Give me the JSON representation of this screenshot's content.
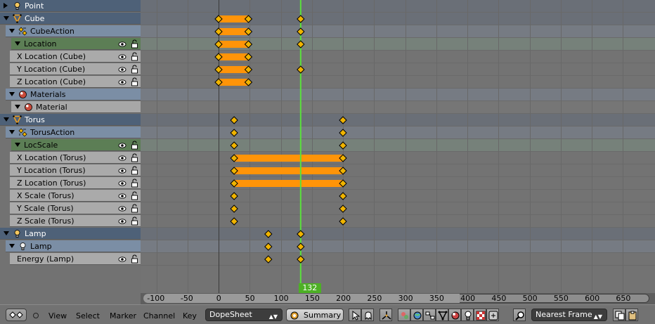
{
  "channels": [
    {
      "label": "Point",
      "level": "object",
      "indent": 0,
      "icon": "lamp-icon",
      "expanded": false
    },
    {
      "label": "Cube",
      "level": "object",
      "indent": 0,
      "icon": "mesh-icon",
      "expanded": true
    },
    {
      "label": "CubeAction",
      "level": "action",
      "indent": 1,
      "icon": "action-icon",
      "expanded": true
    },
    {
      "label": "Location",
      "level": "group",
      "indent": 2,
      "icon": "",
      "expanded": true
    },
    {
      "label": "X Location (Cube)",
      "level": "fcurve",
      "indent": 3,
      "icon": ""
    },
    {
      "label": "Y Location (Cube)",
      "level": "fcurve",
      "indent": 3,
      "icon": ""
    },
    {
      "label": "Z Location (Cube)",
      "level": "fcurve",
      "indent": 3,
      "icon": ""
    },
    {
      "label": "Materials",
      "level": "matgroup",
      "indent": 1,
      "icon": "material-icon",
      "expanded": true
    },
    {
      "label": "Material",
      "level": "material",
      "indent": 2,
      "icon": "material-icon",
      "expanded": true
    },
    {
      "label": "Torus",
      "level": "object",
      "indent": 0,
      "icon": "mesh-icon",
      "expanded": true
    },
    {
      "label": "TorusAction",
      "level": "action",
      "indent": 1,
      "icon": "action-icon",
      "expanded": true
    },
    {
      "label": "LocScale",
      "level": "group",
      "indent": 2,
      "icon": "",
      "expanded": true
    },
    {
      "label": "X Location (Torus)",
      "level": "fcurve",
      "indent": 3,
      "icon": ""
    },
    {
      "label": "Y Location (Torus)",
      "level": "fcurve",
      "indent": 3,
      "icon": ""
    },
    {
      "label": "Z Location (Torus)",
      "level": "fcurve",
      "indent": 3,
      "icon": ""
    },
    {
      "label": "X Scale (Torus)",
      "level": "fcurve",
      "indent": 3,
      "icon": ""
    },
    {
      "label": "Y Scale (Torus)",
      "level": "fcurve",
      "indent": 3,
      "icon": ""
    },
    {
      "label": "Z Scale (Torus)",
      "level": "fcurve",
      "indent": 3,
      "icon": ""
    },
    {
      "label": "Lamp",
      "level": "object",
      "indent": 0,
      "icon": "lamp-icon",
      "expanded": true
    },
    {
      "label": "Lamp",
      "level": "action",
      "indent": 1,
      "icon": "lamp-data-icon",
      "expanded": true
    },
    {
      "label": "Energy (Lamp)",
      "level": "fcurve",
      "indent": 1,
      "icon": ""
    }
  ],
  "keyframes": [
    {
      "row": 1,
      "frames": [
        0,
        48,
        132
      ],
      "holds": [
        [
          0,
          48
        ]
      ]
    },
    {
      "row": 2,
      "frames": [
        0,
        48,
        132
      ],
      "holds": [
        [
          0,
          48
        ]
      ]
    },
    {
      "row": 3,
      "frames": [
        0,
        48,
        132
      ],
      "holds": [
        [
          0,
          48
        ]
      ]
    },
    {
      "row": 4,
      "frames": [
        0,
        48
      ],
      "holds": [
        [
          0,
          48
        ]
      ]
    },
    {
      "row": 5,
      "frames": [
        0,
        48,
        132
      ],
      "holds": [
        [
          0,
          48
        ]
      ]
    },
    {
      "row": 6,
      "frames": [
        0,
        48
      ],
      "holds": [
        [
          0,
          48
        ]
      ]
    },
    {
      "row": 9,
      "frames": [
        25,
        200
      ],
      "holds": []
    },
    {
      "row": 10,
      "frames": [
        25,
        200
      ],
      "holds": []
    },
    {
      "row": 11,
      "frames": [
        25,
        200
      ],
      "holds": []
    },
    {
      "row": 12,
      "frames": [
        25,
        200
      ],
      "holds": [
        [
          25,
          200
        ]
      ]
    },
    {
      "row": 13,
      "frames": [
        25,
        200
      ],
      "holds": [
        [
          25,
          200
        ]
      ]
    },
    {
      "row": 14,
      "frames": [
        25,
        200
      ],
      "holds": [
        [
          25,
          200
        ]
      ]
    },
    {
      "row": 15,
      "frames": [
        25,
        200
      ],
      "holds": []
    },
    {
      "row": 16,
      "frames": [
        25,
        200
      ],
      "holds": []
    },
    {
      "row": 17,
      "frames": [
        25,
        200
      ],
      "holds": []
    },
    {
      "row": 18,
      "frames": [
        80,
        132
      ],
      "holds": []
    },
    {
      "row": 19,
      "frames": [
        80,
        132
      ],
      "holds": []
    },
    {
      "row": 20,
      "frames": [
        80,
        132
      ],
      "holds": []
    }
  ],
  "timeline": {
    "ticks": [
      "-100",
      "-50",
      "0",
      "50",
      "100",
      "150",
      "200",
      "250",
      "300",
      "350",
      "400",
      "450",
      "500",
      "550",
      "600",
      "650"
    ],
    "tick_values": [
      -100,
      -50,
      0,
      50,
      100,
      150,
      200,
      250,
      300,
      350,
      400,
      450,
      500,
      550,
      600,
      650
    ],
    "current_frame": "132",
    "current_frame_value": 132
  },
  "colors": {
    "keyframe": "#f0b400",
    "hold": "#ff9408",
    "playhead": "#5ae03c",
    "frame_badge": "#4db025"
  },
  "header": {
    "menus": [
      "View",
      "Select",
      "Marker",
      "Channel",
      "Key"
    ],
    "mode": "DopeSheet",
    "summary_label": "Summary",
    "snap": "Nearest Frame"
  }
}
